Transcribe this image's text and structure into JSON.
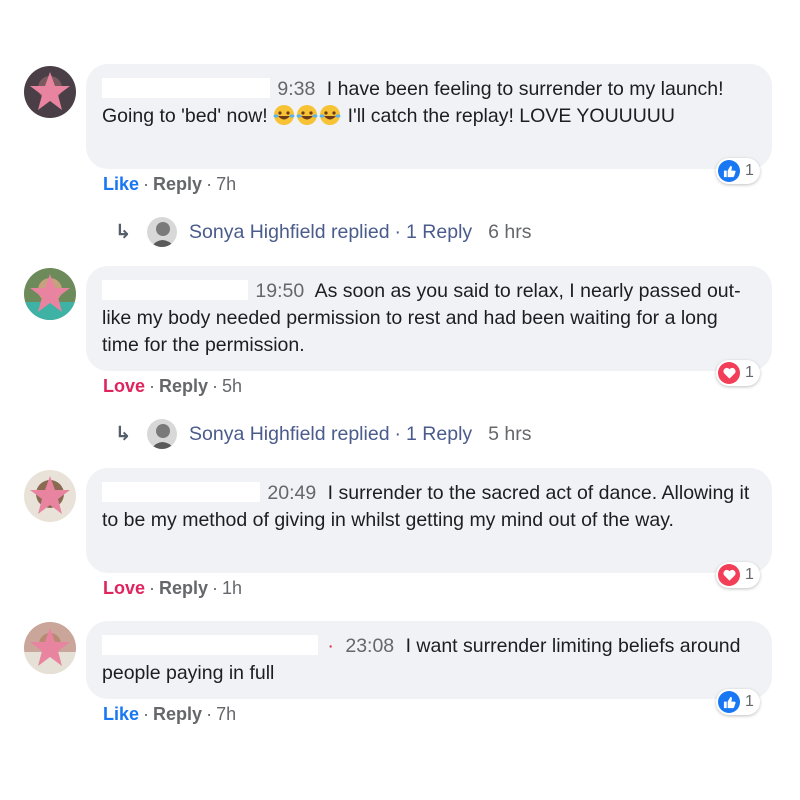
{
  "comments": [
    {
      "time": "9:38",
      "text": "I have been feeling to surrender to my launch! Going to 'bed' now! 😂😂😂 I'll catch the replay! LOVE YOUUUUU",
      "text_before_emoji": "I have been feeling to surrender to my launch! Going to 'bed' now!",
      "text_after_emoji": "I'll catch the replay! LOVE YOUUUUU",
      "emoji_name": "tears-of-joy-icon",
      "reaction_action": "Like",
      "reply_label": "Reply",
      "age": "7h",
      "reaction_count": "1",
      "reaction_icon": "like-icon",
      "replied": {
        "who": "Sonya Highfield replied",
        "sep": "·",
        "count": "1 Reply",
        "hrs": "6 hrs"
      }
    },
    {
      "time": "19:50",
      "text": "As soon as you said to relax, I nearly passed out- like my body needed permission to rest and had been waiting for a long time for the permission.",
      "reaction_action": "Love",
      "reply_label": "Reply",
      "age": "5h",
      "reaction_count": "1",
      "reaction_icon": "love-icon",
      "replied": {
        "who": "Sonya Highfield replied",
        "sep": "·",
        "count": "1 Reply",
        "hrs": "5 hrs"
      }
    },
    {
      "time": "20:49",
      "text": "I surrender to the sacred act of dance. Allowing it to be my method of giving in whilst getting my mind out of the way.",
      "reaction_action": "Love",
      "reply_label": "Reply",
      "age": "1h",
      "reaction_count": "1",
      "reaction_icon": "love-icon"
    },
    {
      "time": "23:08",
      "text": "I want surrender limiting beliefs around people paying in full",
      "reaction_action": "Like",
      "reply_label": "Reply",
      "age": "7h",
      "reaction_count": "1",
      "reaction_icon": "like-icon"
    }
  ],
  "separator": "·",
  "colors": {
    "like": "#1877f2",
    "love": "#e0245e",
    "bubble": "#f0f2f5",
    "muted": "#65676b"
  }
}
